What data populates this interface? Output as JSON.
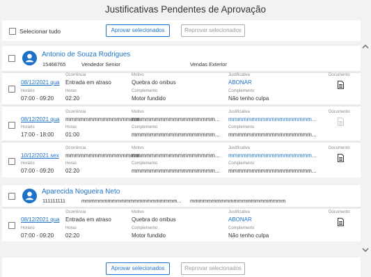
{
  "page": {
    "title": "Justificativas Pendentes de Aprovação"
  },
  "toolbar": {
    "select_all_label": "Selecionar tudo",
    "approve_label": "Aprovar selecionados",
    "reject_label": "Reprovar selecionados"
  },
  "labels": {
    "ocorrencia": "Ocorrência",
    "motivo": "Motivo",
    "justificativa": "Justificativa",
    "documento": "Documento",
    "horario": "Horário",
    "horas": "Horas",
    "complemento": "Complemento"
  },
  "employees": [
    {
      "name": "Antonio de Souza Rodrigues",
      "id": "15468765",
      "role": "Vendedor Senior",
      "department": "Vendas Exterior",
      "records": [
        {
          "date": "08/12/2021 qua",
          "horario": "07:00 - 09:20",
          "ocorrencia": "Entrada em atraso",
          "horas": "02:20",
          "motivo": "Quebra do onibus",
          "complemento": "Motor fundido",
          "justificativa": "ABONAR",
          "complemento_just": "Não tenho culpa",
          "doc": "available"
        },
        {
          "date": "08/12/2021 qua",
          "horario": "17:00 - 18:00",
          "ocorrencia": "mmmmmmmmmmmmmmmm",
          "horas": "01:00",
          "motivo": "mmmmmmmmmmmmmmmmmm...",
          "complemento": "mmmmmmmmmmmmmmmmmm...",
          "justificativa": "mmmmmmmmmmmmmmmmmm...",
          "complemento_just": "mmmmmmmmmmmmmmmmmm...",
          "doc": "disabled"
        },
        {
          "date": "10/12/2021 sex",
          "horario": "07:00 - 09:20",
          "ocorrencia": "mmmmmmmmmmmmmmmm",
          "horas": "02:20",
          "motivo": "mmmmmmmmmmmmmmmmmm...",
          "complemento": "mmmmmmmmmmmmmmmmmm...",
          "justificativa": "mmmmmmmmmmmmmmmmmm...",
          "complemento_just": "mmmmmmmmmmmmmmmmmm...",
          "doc": "available"
        }
      ]
    },
    {
      "name": "Aparecida Nogueira Neto",
      "id": "111111111",
      "role": "mmmmmmmmmmmmmmmmmmmmmm...",
      "department": "mmmmmmmmmmmmmmmmmmmmmm",
      "records": [
        {
          "date": "08/12/2021 qua",
          "horario": "07:00 - 09:20",
          "ocorrencia": "Entrada em atraso",
          "horas": "02:20",
          "motivo": "Quebra do onibus",
          "complemento": "Motor fundido",
          "justificativa": "ABONAR",
          "complemento_just": "Não tenho culpa",
          "doc": "available"
        }
      ]
    }
  ],
  "colors": {
    "accent": "#1d72c8",
    "background": "#f2f2f2",
    "card": "#ffffff",
    "separator": "#e9e9e9"
  },
  "icons": {
    "avatar": "person-circle-icon",
    "document": "document-icon",
    "scroll_up": "chevron-up-icon",
    "scroll_down": "chevron-down-icon"
  }
}
